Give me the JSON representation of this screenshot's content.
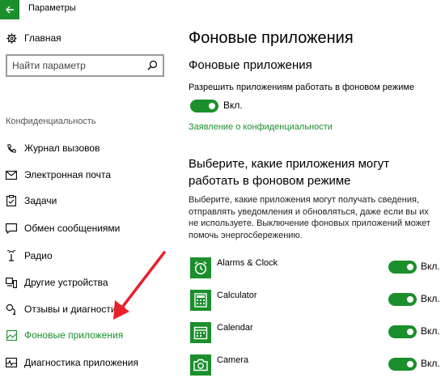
{
  "window": {
    "title": "Параметры"
  },
  "sidebar": {
    "home_label": "Главная",
    "search_placeholder": "Найти параметр",
    "section_label": "Конфиденциальность",
    "items": [
      {
        "label": "Журнал вызовов",
        "icon": "call-history-icon"
      },
      {
        "label": "Электронная почта",
        "icon": "mail-icon"
      },
      {
        "label": "Задачи",
        "icon": "tasks-icon"
      },
      {
        "label": "Обмен сообщениями",
        "icon": "messaging-icon"
      },
      {
        "label": "Радио",
        "icon": "radio-icon"
      },
      {
        "label": "Другие устройства",
        "icon": "devices-icon"
      },
      {
        "label": "Отзывы и диагностика",
        "icon": "feedback-icon"
      },
      {
        "label": "Фоновые приложения",
        "icon": "background-apps-icon",
        "active": true
      },
      {
        "label": "Диагностика приложения",
        "icon": "app-diagnostics-icon"
      }
    ]
  },
  "main": {
    "title": "Фоновые приложения",
    "subtitle": "Фоновые приложения",
    "allow_label": "Разрешить приложениям работать в фоновом режиме",
    "allow_state": "Вкл.",
    "privacy_link": "Заявление о конфиденциальности",
    "choose_title": "Выберите, какие приложения могут работать в фоновом режиме",
    "choose_desc": "Выберите, какие приложения могут получать сведения, отправлять уведомления и обновляться, даже если вы их не используете. Выключение фоновых приложений может помочь энергосбережению.",
    "apps": [
      {
        "name": "Alarms & Clock",
        "state": "Вкл.",
        "icon": "alarm-clock-icon"
      },
      {
        "name": "Calculator",
        "state": "Вкл.",
        "icon": "calculator-icon"
      },
      {
        "name": "Calendar",
        "state": "Вкл.",
        "icon": "calendar-icon"
      },
      {
        "name": "Camera",
        "state": "Вкл.",
        "icon": "camera-icon"
      }
    ]
  },
  "colors": {
    "accent": "#1b8f2c",
    "annotation_arrow": "#e8212b"
  }
}
